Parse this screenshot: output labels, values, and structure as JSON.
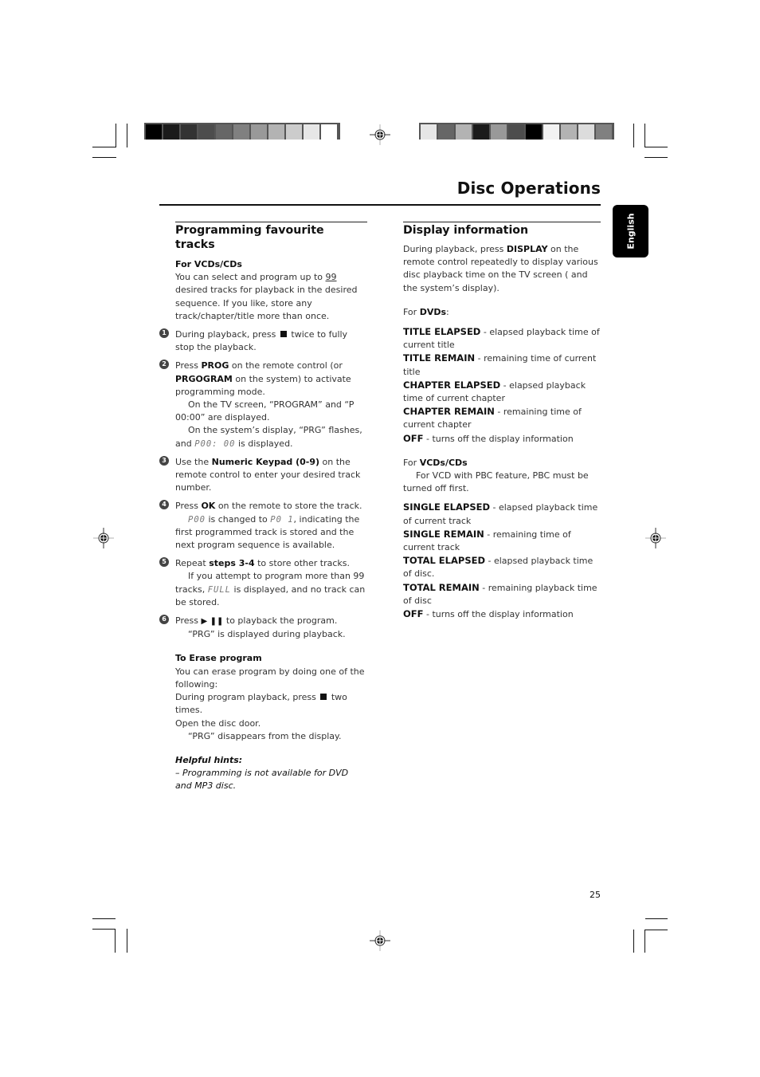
{
  "page": {
    "title": "Disc Operations",
    "language_tab": "English",
    "page_number": "25"
  },
  "color_bars": {
    "left": [
      "#000000",
      "#1b1b1b",
      "#333333",
      "#4d4d4d",
      "#666666",
      "#808080",
      "#999999",
      "#b3b3b3",
      "#cccccc",
      "#e6e6e6",
      "#ffffff"
    ],
    "right": [
      "#e6e6e6",
      "#666666",
      "#b3b3b3",
      "#1b1b1b",
      "#999999",
      "#4d4d4d",
      "#000000",
      "#f2f2f2",
      "#b3b3b3",
      "#dcdcdc",
      "#808080"
    ]
  },
  "left": {
    "heading": "Programming favourite tracks",
    "subheading": "For VCDs/CDs",
    "intro_pre": "You can select and program up to ",
    "intro_num": "99",
    "intro_post": " desired tracks for playback in the desired sequence.  If you like, store any track/chapter/title more than once.",
    "steps": [
      {
        "num": "1",
        "pre": "During playback, press ",
        "post": " twice to fully stop the playback."
      },
      {
        "num": "2",
        "t1": "Press ",
        "b1": "PROG",
        "t2": " on the remote control (or ",
        "b2": "PRGOGRAM",
        "t3": " on the system) to activate programming mode.",
        "note1": "On the TV screen, “PROGRAM” and “P 00:00” are displayed.",
        "note2": "On the system’s display, “PRG” flashes, and ",
        "lcd": "P00: 00",
        "note2_post": " is displayed."
      },
      {
        "num": "3",
        "t1": "Use the ",
        "b1": "Numeric Keypad (0-9)",
        "t2": " on the remote control to enter your desired track number."
      },
      {
        "num": "4",
        "t1": "Press ",
        "b1": "OK",
        "t2": " on the remote to store the track.",
        "lcd1": "P00",
        "n1": " is changed to ",
        "lcd2": "P0 1",
        "n2": ", indicating the first programmed track is stored and the next program sequence is available."
      },
      {
        "num": "5",
        "t1": "Repeat ",
        "b1": "steps 3-4",
        "t2": " to store other tracks.",
        "n1": "If you attempt to program more than 99 tracks, ",
        "lcd": "FULL",
        "n2": " is displayed, and no track can be stored."
      },
      {
        "num": "6",
        "t1": "Press ",
        "sym": "▶ ❚❚",
        "t2": " to playback the program.",
        "note": "“PRG”  is displayed during playback."
      }
    ],
    "erase": {
      "heading": "To Erase program",
      "line1": "You can erase program by doing one of the following:",
      "line2_pre": "During program playback, press ",
      "line2_post": " two times.",
      "line3": "Open the disc door.",
      "note": "“PRG” disappears from the display."
    },
    "hints": {
      "heading": "Helpful hints:",
      "text": "–   Programming is not available for DVD and MP3 disc."
    }
  },
  "right": {
    "heading": "Display information",
    "intro_pre": "During playback, press ",
    "intro_bold": "DISPLAY",
    "intro_post": " on the remote control repeatedly to display various disc playback time on the TV screen ( and the system’s display).",
    "dvd_label_pre": "For ",
    "dvd_label_bold": "DVDs",
    "dvd_label_post": ":",
    "dvd_items": [
      {
        "term": "TITLE ELAPSED",
        "desc": " - elapsed playback time of current title"
      },
      {
        "term": "TITLE REMAIN",
        "desc": " - remaining time of current title"
      },
      {
        "term": "CHAPTER ELAPSED",
        "desc": " - elapsed playback time of current chapter"
      },
      {
        "term": "CHAPTER REMAIN",
        "desc": " - remaining time of current chapter"
      },
      {
        "term": "OFF",
        "desc": " - turns off the display information"
      }
    ],
    "vcd_label_pre": "For ",
    "vcd_label_bold": "VCDs/CDs",
    "vcd_note": "For VCD with PBC feature, PBC must be turned off first.",
    "vcd_items": [
      {
        "term": "SINGLE ELAPSED",
        "desc": " - elapsed playback time of current track"
      },
      {
        "term": "SINGLE REMAIN",
        "desc": " - remaining time of current track"
      },
      {
        "term": "TOTAL ELAPSED",
        "desc": " - elapsed playback time of disc."
      },
      {
        "term": "TOTAL REMAIN",
        "desc": " - remaining playback time of disc"
      },
      {
        "term": "OFF",
        "desc": " - turns off the display information"
      }
    ]
  }
}
